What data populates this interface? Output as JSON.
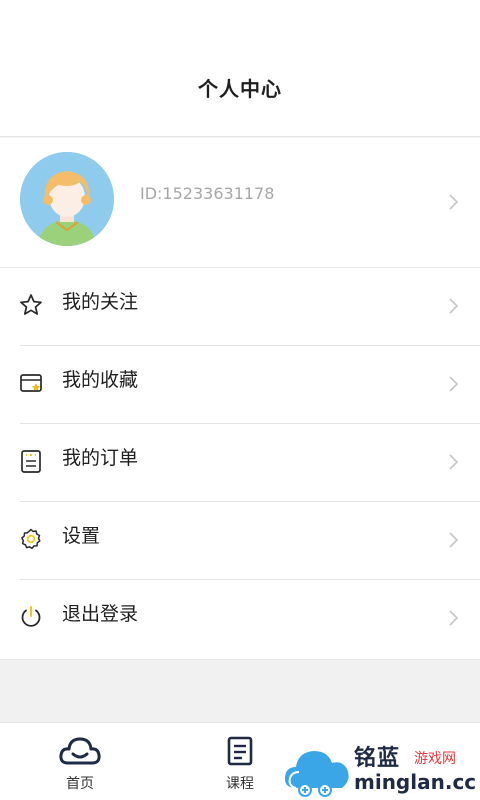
{
  "header": {
    "title": "个人中心"
  },
  "profile": {
    "id_text": "ID:15233631178",
    "avatar_icon": "avatar-icon"
  },
  "menu": {
    "items": [
      {
        "label": "我的关注",
        "icon": "star-icon"
      },
      {
        "label": "我的收藏",
        "icon": "favorites-icon"
      },
      {
        "label": "我的订单",
        "icon": "order-icon"
      },
      {
        "label": "设置",
        "icon": "gear-icon"
      },
      {
        "label": "退出登录",
        "icon": "power-icon"
      }
    ]
  },
  "tabbar": {
    "tabs": [
      {
        "label": "首页",
        "icon": "home-icon"
      },
      {
        "label": "课程",
        "icon": "course-icon"
      }
    ]
  },
  "watermark": {
    "brand_cn": "铭蓝",
    "brand_cn_suffix": "游戏网",
    "brand_domain": "minglan.cc"
  },
  "colors": {
    "background": "#f1f1f1",
    "surface": "#ffffff",
    "text": "#1f1f1f",
    "muted": "#a6a6a6",
    "divider": "#e3e3e3"
  }
}
